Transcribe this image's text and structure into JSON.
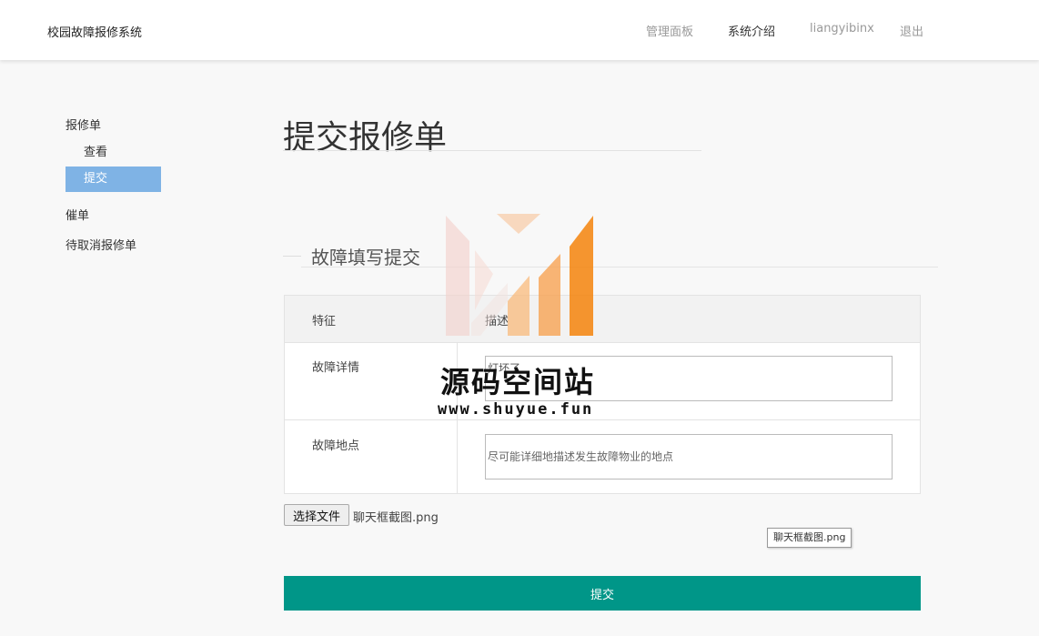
{
  "header": {
    "brand": "校园故障报修系统",
    "nav": [
      {
        "label": "管理面板"
      },
      {
        "label": "系统介绍"
      },
      {
        "label": "liangyibinx"
      },
      {
        "label": "退出"
      }
    ]
  },
  "sidebar": {
    "group1": "报修单",
    "items": [
      {
        "label": "查看"
      },
      {
        "label": "提交"
      }
    ],
    "group2": "催单",
    "group3": "待取消报修单"
  },
  "main": {
    "title": "提交报修单",
    "section_title": "故障填写提交",
    "table": {
      "headers": [
        "特征",
        "描述"
      ],
      "rows": [
        {
          "label": "故障详情",
          "value": "灯坏了",
          "placeholder": ""
        },
        {
          "label": "故障地点",
          "value": "",
          "placeholder": "尽可能详细地描述发生故障物业的地点"
        }
      ]
    },
    "file": {
      "button_label": "选择文件",
      "file_name": "聊天框截图.png",
      "tooltip": "聊天框截图.png"
    },
    "submit_label": "提交"
  },
  "watermark": {
    "text": "源码空间站",
    "url": "www.shuyue.fun"
  },
  "colors": {
    "active_sidebar": "#7fb3e5",
    "submit": "#009688",
    "page_bg": "#f8f8f8",
    "logo_orange": "#f5840c"
  }
}
